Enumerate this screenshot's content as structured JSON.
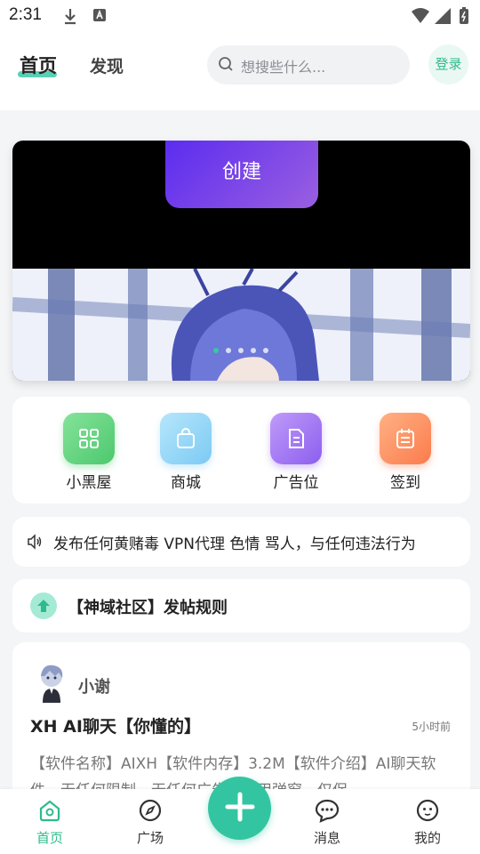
{
  "status_bar": {
    "time": "2:31"
  },
  "header": {
    "tab_home": "首页",
    "tab_discover": "发现",
    "search_placeholder": "想搜些什么...",
    "login_label": "登录"
  },
  "banner": {
    "button_label": "创建",
    "page_count": 5,
    "active_index": 0
  },
  "quick_actions": [
    {
      "label": "小黑屋",
      "icon": "grid-icon",
      "color": "#5fd07a"
    },
    {
      "label": "商城",
      "icon": "bag-icon",
      "color": "#8fd3f7"
    },
    {
      "label": "广告位",
      "icon": "document-icon",
      "color": "#a377f2"
    },
    {
      "label": "签到",
      "icon": "calendar-icon",
      "color": "#fd8f5c"
    }
  ],
  "notice": {
    "text": "发布任何黄赌毒 VPN代理 色情 骂人，与任何违法行为"
  },
  "rule": {
    "label": "【神域社区】发帖规则"
  },
  "post": {
    "author": "小谢",
    "title": "XH AI聊天【你懂的】",
    "time": "5小时前",
    "body": "【软件名称】AIXH【软件内存】3.2M【软件介绍】AI聊天软件，无任何限制，无任何广告和无用弹窗，仅保"
  },
  "bottom_nav": [
    {
      "label": "首页",
      "icon": "home-icon",
      "active": true
    },
    {
      "label": "广场",
      "icon": "compass-icon",
      "active": false
    },
    {
      "label": "消息",
      "icon": "chat-icon",
      "active": false
    },
    {
      "label": "我的",
      "icon": "profile-icon",
      "active": false
    }
  ],
  "colors": {
    "accent": "#33c5a2",
    "accent_text": "#2fba8c"
  }
}
